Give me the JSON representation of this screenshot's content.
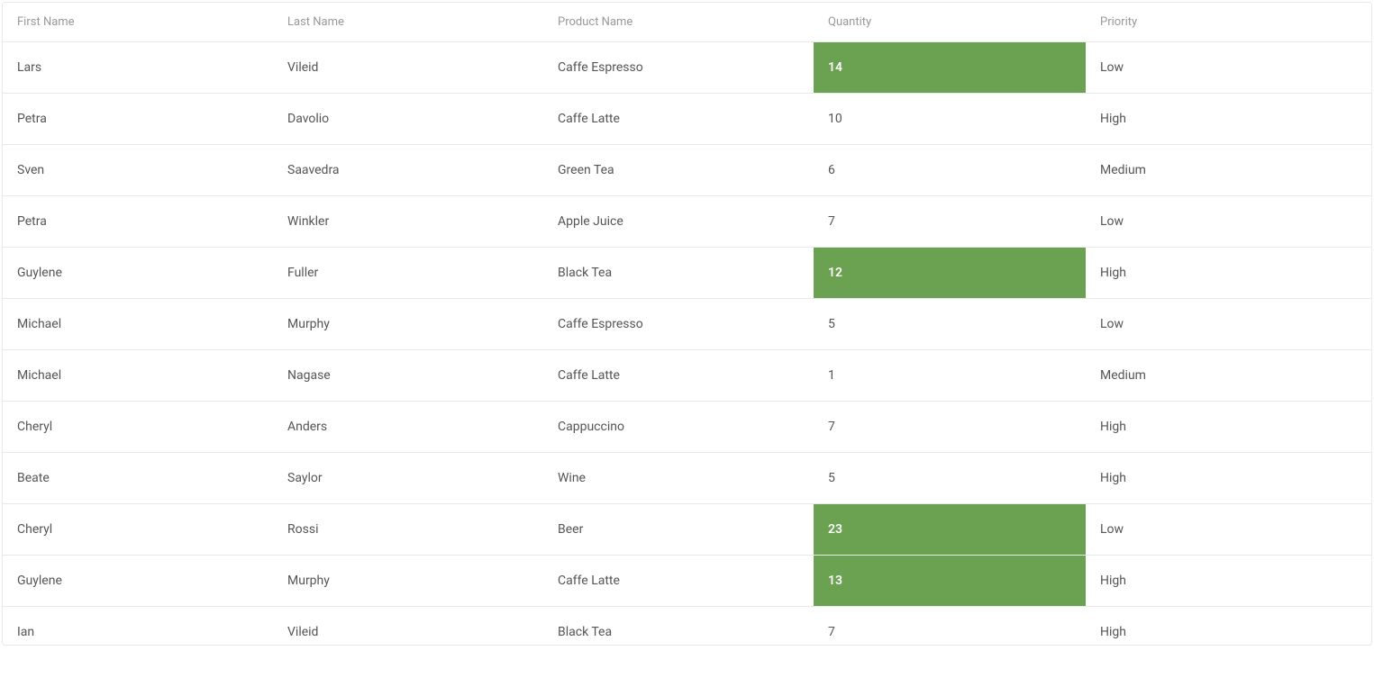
{
  "highlightColor": "#6aa251",
  "highlightThreshold": 12,
  "columns": [
    {
      "key": "firstName",
      "label": "First Name",
      "cssClass": "col-firstname"
    },
    {
      "key": "lastName",
      "label": "Last Name",
      "cssClass": "col-lastname"
    },
    {
      "key": "productName",
      "label": "Product Name",
      "cssClass": "col-product"
    },
    {
      "key": "quantity",
      "label": "Quantity",
      "cssClass": "col-quantity"
    },
    {
      "key": "priority",
      "label": "Priority",
      "cssClass": "col-priority"
    }
  ],
  "rows": [
    {
      "firstName": "Lars",
      "lastName": "Vileid",
      "productName": "Caffe Espresso",
      "quantity": 14,
      "priority": "Low"
    },
    {
      "firstName": "Petra",
      "lastName": "Davolio",
      "productName": "Caffe Latte",
      "quantity": 10,
      "priority": "High"
    },
    {
      "firstName": "Sven",
      "lastName": "Saavedra",
      "productName": "Green Tea",
      "quantity": 6,
      "priority": "Medium"
    },
    {
      "firstName": "Petra",
      "lastName": "Winkler",
      "productName": "Apple Juice",
      "quantity": 7,
      "priority": "Low"
    },
    {
      "firstName": "Guylene",
      "lastName": "Fuller",
      "productName": "Black Tea",
      "quantity": 12,
      "priority": "High"
    },
    {
      "firstName": "Michael",
      "lastName": "Murphy",
      "productName": "Caffe Espresso",
      "quantity": 5,
      "priority": "Low"
    },
    {
      "firstName": "Michael",
      "lastName": "Nagase",
      "productName": "Caffe Latte",
      "quantity": 1,
      "priority": "Medium"
    },
    {
      "firstName": "Cheryl",
      "lastName": "Anders",
      "productName": "Cappuccino",
      "quantity": 7,
      "priority": "High"
    },
    {
      "firstName": "Beate",
      "lastName": "Saylor",
      "productName": "Wine",
      "quantity": 5,
      "priority": "High"
    },
    {
      "firstName": "Cheryl",
      "lastName": "Rossi",
      "productName": "Beer",
      "quantity": 23,
      "priority": "Low"
    },
    {
      "firstName": "Guylene",
      "lastName": "Murphy",
      "productName": "Caffe Latte",
      "quantity": 13,
      "priority": "High"
    },
    {
      "firstName": "Ian",
      "lastName": "Vileid",
      "productName": "Black Tea",
      "quantity": 7,
      "priority": "High"
    }
  ]
}
